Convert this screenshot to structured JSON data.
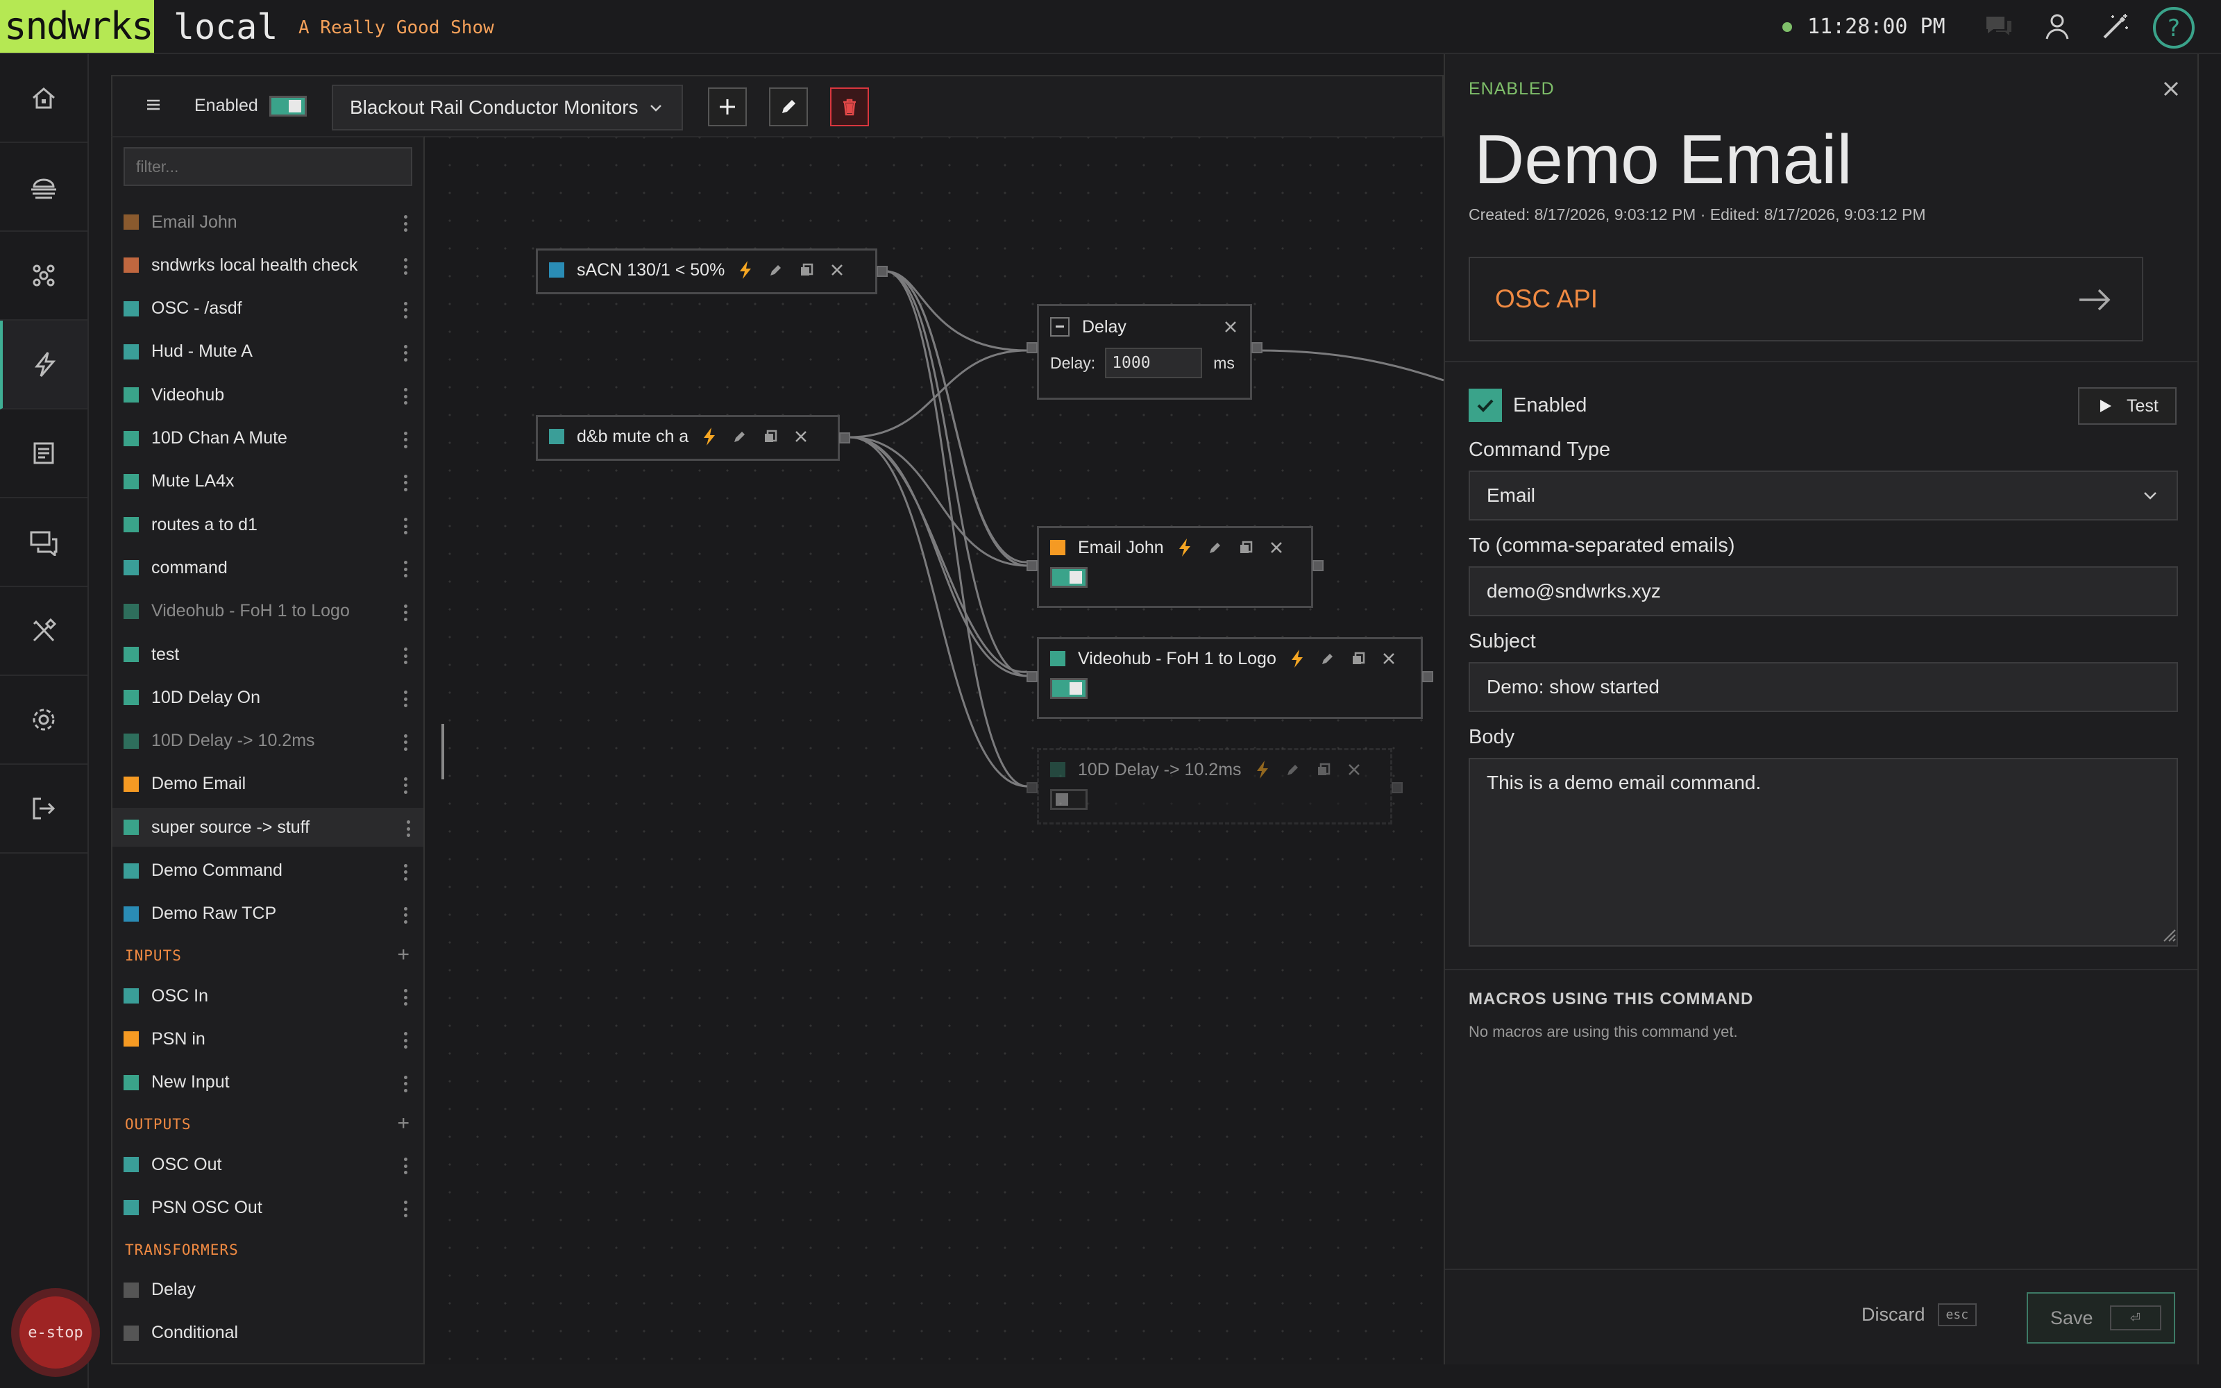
{
  "app": {
    "brand": "sndwrks",
    "name": "local",
    "show": "A Really Good Show",
    "clock": "11:28:00 PM"
  },
  "toolbar": {
    "enabled_label": "Enabled",
    "macro_select": "Blackout Rail Conductor Monitors"
  },
  "sidebar": {
    "filter_placeholder": "filter...",
    "macros": [
      {
        "label": "Email John",
        "color": "#8a5a2e",
        "dim": true
      },
      {
        "label": "sndwrks local health check",
        "color": "#c0673f"
      },
      {
        "label": "OSC - /asdf",
        "color": "#3a9e98"
      },
      {
        "label": "Hud - Mute A",
        "color": "#3a9e98"
      },
      {
        "label": "Videohub",
        "color": "#3aa38a"
      },
      {
        "label": "10D Chan A Mute",
        "color": "#3aa38a"
      },
      {
        "label": "Mute LA4x",
        "color": "#3aa38a"
      },
      {
        "label": "routes a to d1",
        "color": "#3aa38a"
      },
      {
        "label": "command",
        "color": "#3a9e98"
      },
      {
        "label": "Videohub - FoH 1 to Logo",
        "color": "#2e6e5c",
        "dim": true
      },
      {
        "label": "test",
        "color": "#3aa38a"
      },
      {
        "label": "10D Delay On",
        "color": "#3aa38a"
      },
      {
        "label": "10D Delay -> 10.2ms",
        "color": "#2e6e5c",
        "dim": true
      },
      {
        "label": "Demo Email",
        "color": "#f59a23"
      },
      {
        "label": "super source -> stuff",
        "color": "#3aa38a",
        "hover": true
      },
      {
        "label": "Demo Command",
        "color": "#3a9e98"
      },
      {
        "label": "Demo Raw TCP",
        "color": "#2a8cb5"
      }
    ],
    "inputs_title": "INPUTS",
    "inputs": [
      {
        "label": "OSC In",
        "color": "#3a9e98"
      },
      {
        "label": "PSN in",
        "color": "#f59a23"
      },
      {
        "label": "New Input",
        "color": "#3aa38a"
      }
    ],
    "outputs_title": "OUTPUTS",
    "outputs": [
      {
        "label": "OSC Out",
        "color": "#3a9e98"
      },
      {
        "label": "PSN OSC Out",
        "color": "#3a9e98"
      }
    ],
    "transformers_title": "TRANSFORMERS",
    "transformers": [
      {
        "label": "Delay",
        "color": "#555"
      },
      {
        "label": "Conditional",
        "color": "#555"
      }
    ]
  },
  "canvas": {
    "triggers": [
      {
        "label": "sACN 130/1 < 50%"
      },
      {
        "label": "d&b mute ch a"
      }
    ],
    "delay_node": {
      "title": "Delay",
      "field_label": "Delay:",
      "value": "1000",
      "unit": "ms"
    },
    "commands": [
      {
        "label": "Email John",
        "color": "#f59a23"
      },
      {
        "label": "Videohub - FoH 1 to Logo",
        "color": "#3aa38a"
      },
      {
        "label": "10D Delay -> 10.2ms",
        "color": "#2e6e5c"
      }
    ]
  },
  "panel": {
    "status": "ENABLED",
    "title": "Demo Email",
    "meta": "Created: 8/17/2026, 9:03:12 PM · Edited: 8/17/2026, 9:03:12 PM",
    "api_link": "OSC API",
    "enabled_label": "Enabled",
    "test_label": "Test",
    "command_type_label": "Command Type",
    "command_type": "Email",
    "to_label": "To (comma-separated emails)",
    "to_value": "demo@sndwrks.xyz",
    "subject_label": "Subject",
    "subject_value": "Demo: show started",
    "body_label": "Body",
    "body_value": "This is a demo email command.",
    "macros_title": "MACROS USING THIS COMMAND",
    "macros_empty": "No macros are using this command yet.",
    "discard_label": "Discard",
    "discard_key": "esc",
    "save_label": "Save",
    "save_key": "⏎"
  },
  "colors": {
    "accent": "#3aa38a",
    "orange": "#f08a42",
    "bolt": "#f5a623",
    "danger": "#d9363e"
  },
  "estop": "e-stop"
}
